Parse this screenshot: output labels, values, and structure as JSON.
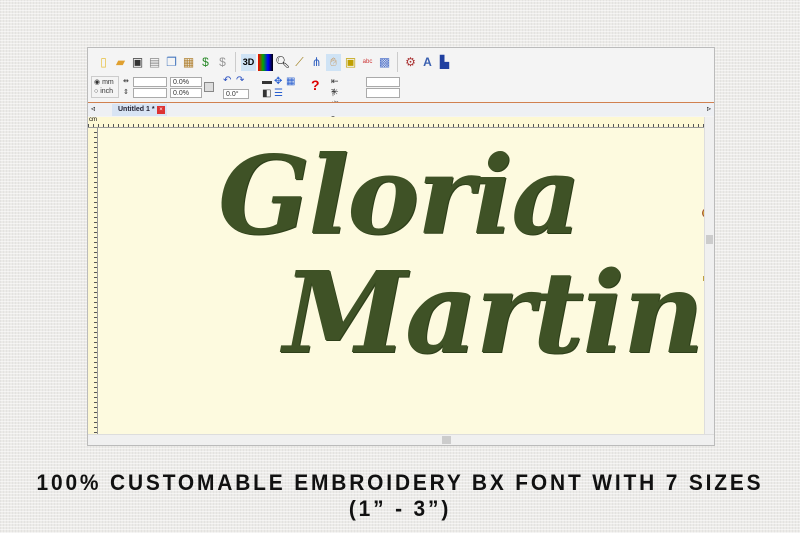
{
  "toolbar": {
    "icons": [
      "new-icon",
      "open-icon",
      "save-icon",
      "print-icon",
      "copy-icon",
      "paste-icon",
      "mirror-icon",
      "rotate-icon",
      "3d-view-icon",
      "color-bars-icon",
      "zoom-icon",
      "ruler-icon",
      "stitch-icon",
      "hand-icon",
      "frame-icon",
      "abc-icon",
      "pattern-icon",
      "settings-icon",
      "text-icon",
      "export-icon"
    ],
    "label_3d": "3D",
    "label_a": "A"
  },
  "units": {
    "mm": "mm",
    "inch": "inch",
    "selected": "mm"
  },
  "fields": {
    "width": "",
    "height": "",
    "width_pct": "0.0%",
    "height_pct": "0.0%",
    "angle": "0.0°",
    "x": "",
    "y": ""
  },
  "tab": {
    "label": "Untitled 1 *"
  },
  "ruler": {
    "unit": "cm"
  },
  "design": {
    "line1": "Gloria",
    "line2": "Martin",
    "color": "#3f5226"
  },
  "caption": "100% CUSTOMABLE EMBROIDERY BX FONT WITH 7 SIZES (1” -  3”)"
}
